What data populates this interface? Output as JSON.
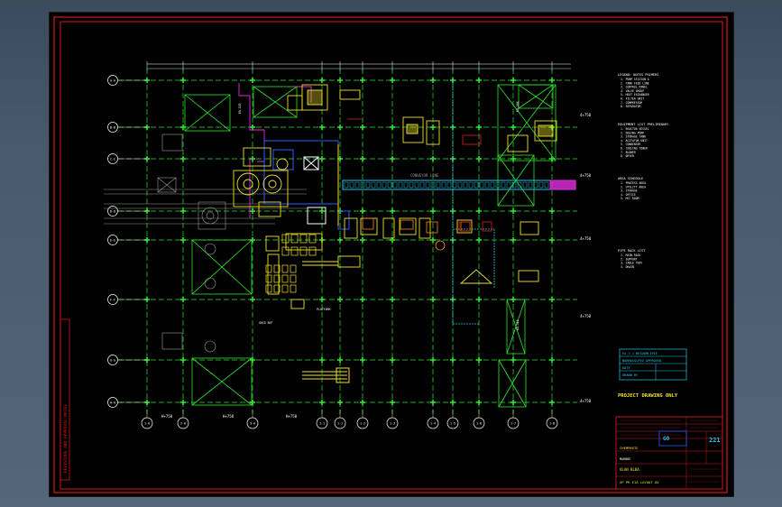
{
  "drawing": {
    "title_block": {
      "note_big": "PROJECT DRAWING ONLY",
      "row_heads": [
        "Ex.r.1 BEIDEMLIPIE",
        "NORMASSLPEO APPROVED",
        "DATE",
        "DRAWN BY"
      ],
      "right_code": "221",
      "right_sub": "GO",
      "company": "CHEMPNSTE",
      "client_line": "MARBBE",
      "drawing_name": "ULAN BLBA",
      "drawing_no": "XP PR E1A LAYOUT 04"
    },
    "grid_columns_bottom": [
      "1-A",
      "2-A",
      "3-A",
      "1-1",
      "1-1",
      "1-2",
      "1-3",
      "1-4",
      "1-5",
      "1-6",
      "1-7",
      "1-8",
      "1-9",
      "1-10",
      "1-11"
    ],
    "grid_rows_left": [
      "A-A",
      "B-B",
      "C-C",
      "D-D",
      "E-E",
      "F-F",
      "G-G",
      "H-H"
    ],
    "grid_rows_right": [
      "4+750",
      "4+750",
      "4+750",
      "4+750",
      "4+750",
      "4+750"
    ],
    "elev_labels": [
      "H+750",
      "H+750"
    ],
    "notes_blocks": [
      {
        "title": "LEGEND: NOTES PRIMERS",
        "lines": [
          "1. PUMP STATION A",
          "2. TANK FEED LINE",
          "3. CONTROL PANEL",
          "4. VALVE GROUP",
          "5. HEAT EXCHANGER",
          "6. FILTER UNIT",
          "7. COMPRESSOR",
          "8. SEPARATOR"
        ]
      },
      {
        "title": "EQUIPMENT LIST PRELIMINARY",
        "lines": [
          "1. REACTOR VESSEL",
          "2. DOSING PUMP",
          "3. STORAGE TANK",
          "4. AGITATOR UNIT",
          "5. CONDENSER",
          "6. COOLING TOWER",
          "7. BLOWER",
          "8. DRYER"
        ]
      },
      {
        "title": "PIPE RACK LIST",
        "lines": [
          "1. MAIN RACK",
          "2. SUPPORT",
          "3. CABLE TRAY",
          "4. DRAIN"
        ]
      },
      {
        "title": "AREA SCHEDULE",
        "lines": [
          "1. PROCESS AREA",
          "2. UTILITY AREA",
          "3. STORAGE",
          "4. OFFICE",
          "5. MCC ROOM"
        ]
      }
    ],
    "side_label": "REVISIONS AND APPROVAL NOTES",
    "center_label": "CONVEYOR LINE"
  }
}
